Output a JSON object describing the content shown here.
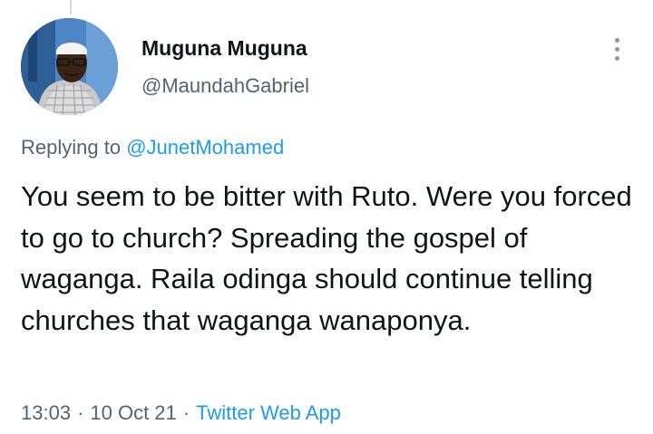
{
  "tweet": {
    "author": {
      "display_name": "Muguna Muguna",
      "handle": "@MaundahGabriel",
      "avatar_icon": "profile-photo"
    },
    "reply": {
      "prefix": "Replying to",
      "mention": "@JunetMohamed"
    },
    "text": "You seem to be bitter with Ruto. Were you forced to go to church? Spreading the gospel of waganga. Raila odinga should continue telling churches that waganga wanaponya.",
    "meta": {
      "time": "13:03",
      "separator": "·",
      "date": "10 Oct 21",
      "source": "Twitter Web App"
    },
    "more_icon": "more-vertical-icon"
  },
  "colors": {
    "primary_text": "#0f1419",
    "secondary_text": "#536471",
    "link": "#1d9bf0"
  }
}
